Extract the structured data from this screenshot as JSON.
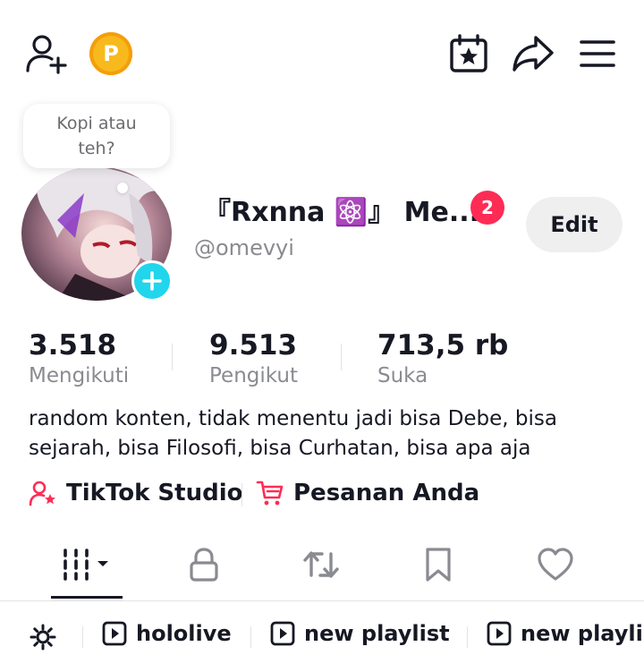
{
  "header": {
    "add_friend_icon": "person-plus-icon",
    "coin_label": "P",
    "coin_color": "#f8b91c",
    "calendar_icon": "calendar-star-icon",
    "share_icon": "share-arrow-icon",
    "menu_icon": "hamburger-menu-icon"
  },
  "note": {
    "text": "Kopi atau teh?"
  },
  "profile": {
    "display_name": "『Rxnna ⚛️』 Me...",
    "notification_count": "2",
    "username": "@omevyi",
    "edit_label": "Edit"
  },
  "stats": [
    {
      "value": "3.518",
      "label": "Mengikuti"
    },
    {
      "value": "9.513",
      "label": "Pengikut"
    },
    {
      "value": "713,5 rb",
      "label": "Suka"
    }
  ],
  "bio": "random konten, tidak menentu jadi bisa Debe, bisa sejarah, bisa Filosofi, bisa Curhatan, bisa apa aja",
  "links": [
    {
      "label": "TikTok Studio",
      "icon": "person-star-icon"
    },
    {
      "label": "Pesanan Anda",
      "icon": "cart-icon"
    }
  ],
  "tabs": [
    {
      "icon": "grid-icon",
      "name": "videos"
    },
    {
      "icon": "lock-icon",
      "name": "private"
    },
    {
      "icon": "repost-icon",
      "name": "reposts"
    },
    {
      "icon": "bookmark-icon",
      "name": "favorites"
    },
    {
      "icon": "heart-icon",
      "name": "liked"
    }
  ],
  "playlists": [
    {
      "label": "hololive"
    },
    {
      "label": "new playlist"
    },
    {
      "label": "new playlis"
    }
  ],
  "colors": {
    "accent": "#fe2c55",
    "badge_blue": "#20d5ec",
    "text": "#161823",
    "muted": "#8a8b91"
  }
}
